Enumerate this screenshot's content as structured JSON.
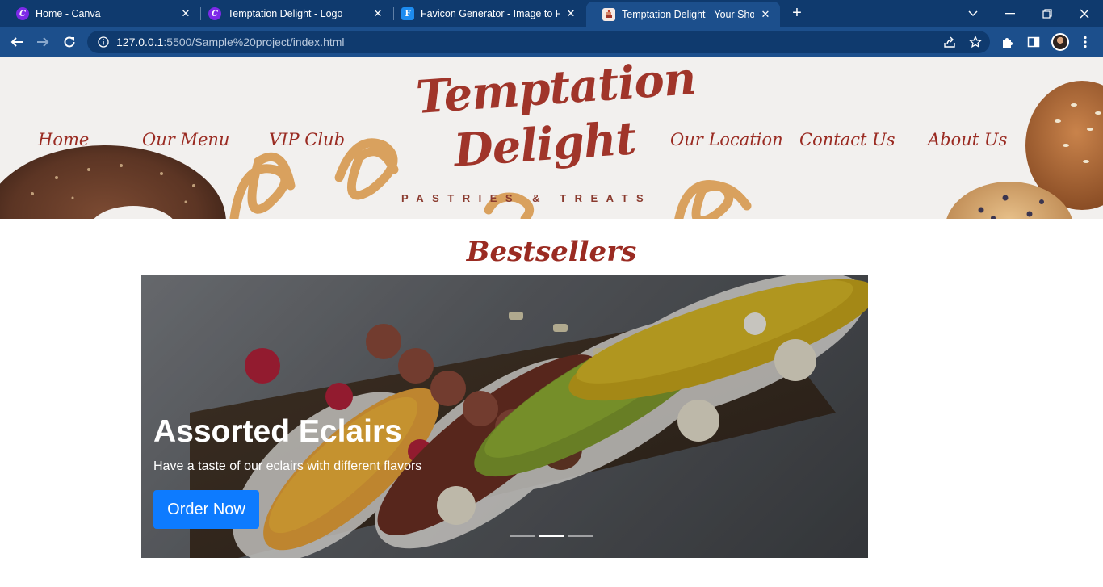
{
  "browser": {
    "tabs": [
      {
        "title": "Home - Canva",
        "icon": "canva-icon",
        "active": false
      },
      {
        "title": "Temptation Delight - Logo",
        "icon": "canva-icon",
        "active": false
      },
      {
        "title": "Favicon Generator - Image to Fav",
        "icon": "favicon-generator-icon",
        "active": false
      },
      {
        "title": "Temptation Delight - Your Shop f",
        "icon": "cake-favicon-icon",
        "active": true
      }
    ],
    "url_host": "127.0.0.1",
    "url_path": ":5500/Sample%20project/index.html"
  },
  "site": {
    "nav_left": [
      "Home",
      "Our Menu",
      "VIP Club"
    ],
    "nav_right": [
      "Our Location",
      "Contact Us",
      "About Us"
    ],
    "logo": {
      "line1": "Temptation",
      "line2": "Delight",
      "tagline": "PASTRIES & TREATS"
    },
    "section_title": "Bestsellers",
    "carousel": {
      "title": "Assorted Eclairs",
      "text": "Have a taste of our eclairs with different flavors",
      "button": "Order Now",
      "slide_count": 3,
      "active_slide": 2
    }
  },
  "colors": {
    "brand": "#9a2b22",
    "button": "#0d7bff",
    "chrome": "#1c4f8c"
  }
}
